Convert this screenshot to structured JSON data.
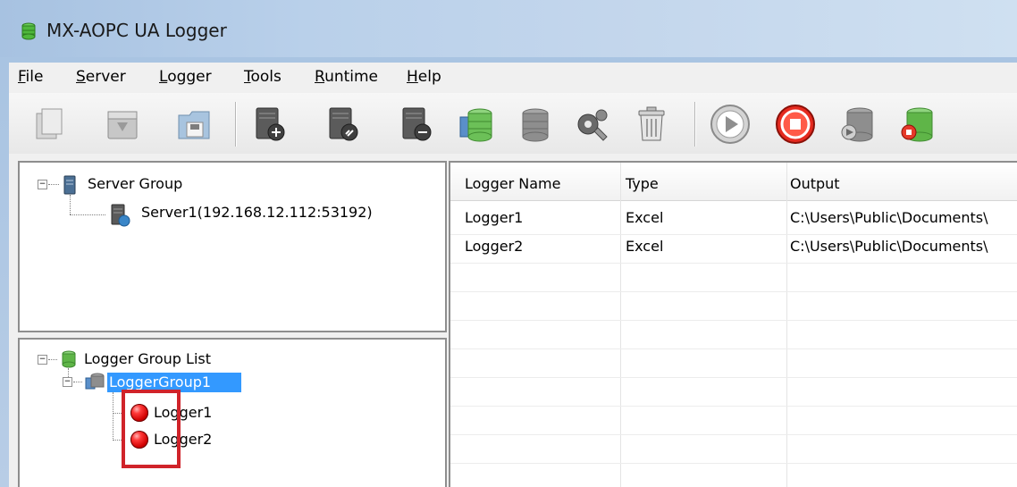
{
  "window": {
    "title": "MX-AOPC UA Logger"
  },
  "menu": [
    {
      "pre": "",
      "u": "F",
      "post": "ile"
    },
    {
      "pre": "",
      "u": "S",
      "post": "erver"
    },
    {
      "pre": "",
      "u": "L",
      "post": "ogger"
    },
    {
      "pre": "",
      "u": "T",
      "post": "ools"
    },
    {
      "pre": "",
      "u": "R",
      "post": "untime"
    },
    {
      "pre": "",
      "u": "H",
      "post": "elp"
    }
  ],
  "toolbar": {
    "icons": [
      "new-icon",
      "open-icon",
      "save-icon",
      "add-server-icon",
      "connect-server-icon",
      "remove-server-icon",
      "add-logger-group-icon",
      "logger-group-icon",
      "settings-icon",
      "delete-icon",
      "play-icon",
      "stop-icon",
      "run-logger-icon",
      "stop-logger-icon"
    ]
  },
  "server_tree": {
    "root": "Server Group",
    "server": "Server1(192.168.12.112:53192)"
  },
  "logger_tree": {
    "root": "Logger Group List",
    "group": "LoggerGroup1",
    "loggers": [
      "Logger1",
      "Logger2"
    ],
    "logger_status_color": "#d00000"
  },
  "logger_list": {
    "columns": [
      "Logger Name",
      "Type",
      "Output"
    ],
    "rows": [
      {
        "name": "Logger1",
        "type": "Excel",
        "output": "C:\\Users\\Public\\Documents\\"
      },
      {
        "name": "Logger2",
        "type": "Excel",
        "output": "C:\\Users\\Public\\Documents\\"
      }
    ]
  },
  "colors": {
    "selection": "#3399ff",
    "highlight_box": "#d0232a"
  }
}
